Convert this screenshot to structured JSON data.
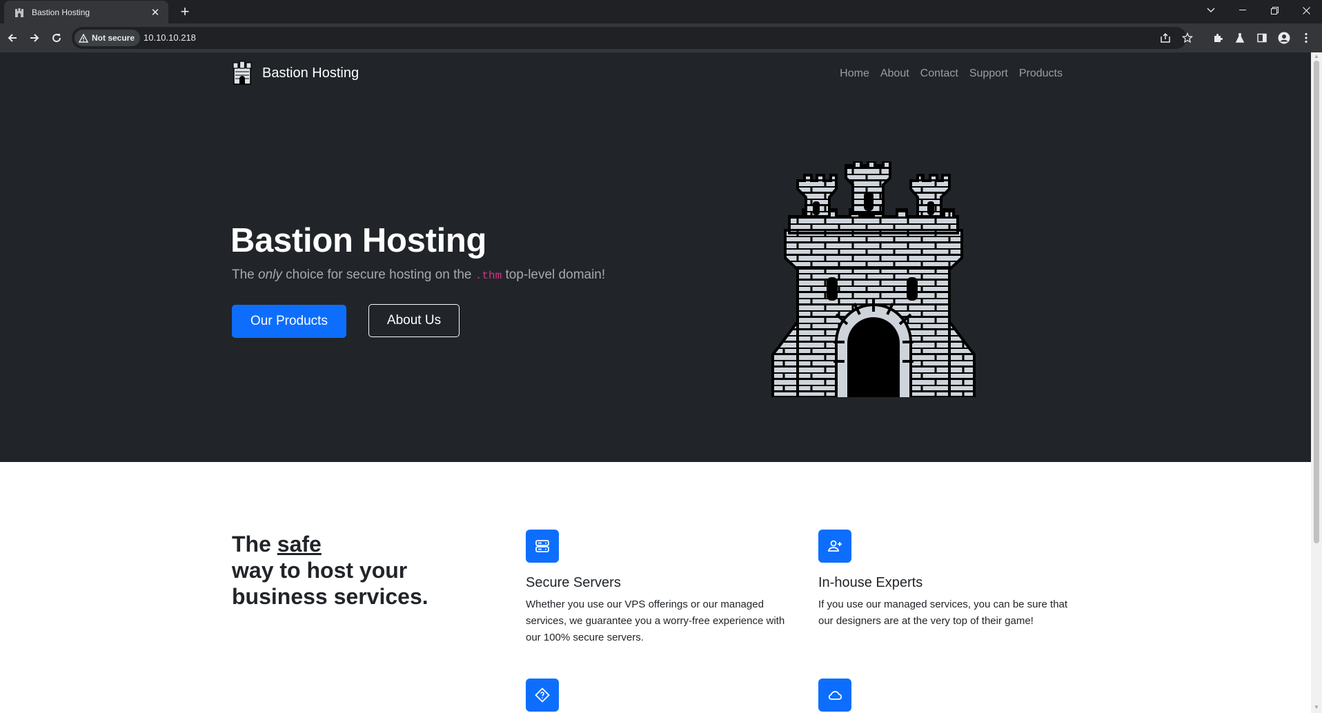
{
  "browser": {
    "tab_title": "Bastion Hosting",
    "security_label": "Not secure",
    "url": "10.10.10.218"
  },
  "site": {
    "brand": "Bastion Hosting",
    "nav": [
      "Home",
      "About",
      "Contact",
      "Support",
      "Products"
    ]
  },
  "hero": {
    "title": "Bastion Hosting",
    "sub_prefix": "The ",
    "sub_emphasis": "only",
    "sub_middle": " choice for secure hosting on the ",
    "sub_code": ".thm",
    "sub_suffix": " top-level domain!",
    "primary_button": "Our Products",
    "secondary_button": "About Us"
  },
  "features": {
    "title_prefix": "The ",
    "title_underlined": "safe",
    "title_suffix": " way to host your business services.",
    "items": [
      {
        "icon": "server-icon",
        "title": "Secure Servers",
        "text": "Whether you use our VPS offerings or our managed services, we guarantee you a worry-free experience with our 100% secure servers."
      },
      {
        "icon": "person-plus-icon",
        "title": "In-house Experts",
        "text": "If you use our managed services, you can be sure that our designers are at the very top of their game!"
      },
      {
        "icon": "signpost-icon",
        "title": "",
        "text": ""
      },
      {
        "icon": "cloud-icon",
        "title": "",
        "text": ""
      }
    ]
  },
  "colors": {
    "hero_bg": "#212529",
    "primary": "#0d6efd",
    "code": "#d63384"
  }
}
